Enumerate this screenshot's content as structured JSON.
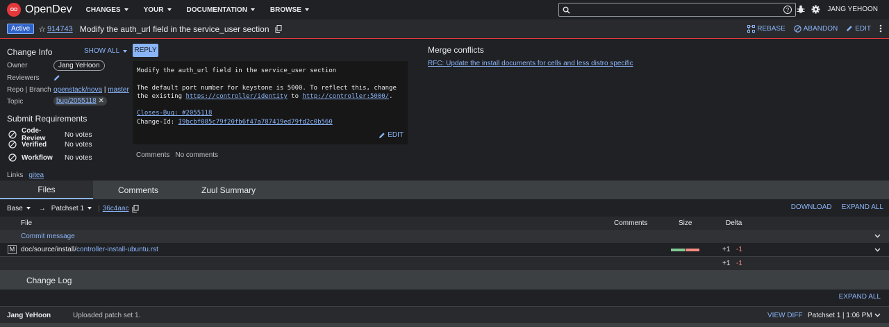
{
  "header": {
    "logo_text": "OpenDev",
    "logo_mark": "OD",
    "nav": [
      "CHANGES",
      "YOUR",
      "DOCUMENTATION",
      "BROWSE"
    ],
    "search_placeholder": "",
    "user": "JANG YEHOON"
  },
  "change": {
    "status": "Active",
    "number": "914743",
    "subject": "Modify the auth_url field in the service_user section",
    "actions": [
      "REBASE",
      "ABANDON",
      "EDIT"
    ]
  },
  "info": {
    "title": "Change Info",
    "show_all": "SHOW ALL",
    "owner_label": "Owner",
    "owner": "Jang YeHoon",
    "reviewers_label": "Reviewers",
    "repo_label": "Repo | Branch",
    "repo": "openstack/nova",
    "sep": "|",
    "branch": "master",
    "topic_label": "Topic",
    "topic": "bug/2055118"
  },
  "requirements": {
    "title": "Submit Requirements",
    "items": [
      {
        "name": "Code-Review",
        "votes": "No votes"
      },
      {
        "name": "Verified",
        "votes": "No votes"
      },
      {
        "name": "Workflow",
        "votes": "No votes"
      }
    ]
  },
  "links": {
    "label": "Links",
    "items": [
      "gitea"
    ]
  },
  "commit": {
    "reply": "REPLY",
    "line1": "Modify the auth_url field in the service_user section",
    "line2": "The default port number for keystone is 5000. To reflect this, change",
    "line3_pre": "the existing ",
    "url1": "https://controller/identity",
    "line3_mid": " to ",
    "url2": "http://controller:5000/",
    "line3_post": ".",
    "closes": "Closes-Bug: #2055118",
    "change_id_label": "Change-Id: ",
    "change_id": "I9bcbf085c79f20fb6f47a787419ed79fd2c0b560",
    "edit": "EDIT",
    "comments_label": "Comments",
    "comments_value": "No comments"
  },
  "merge": {
    "title": "Merge conflicts",
    "link": "RFC: Update the install documents for cells and less distro specific"
  },
  "tabs": [
    "Files",
    "Comments",
    "Zuul Summary"
  ],
  "patchset": {
    "base": "Base",
    "arrow": "→",
    "patchset": "Patchset 1",
    "commit": "36c4aac",
    "download": "DOWNLOAD",
    "expand_all": "EXPAND ALL"
  },
  "files": {
    "headers": {
      "file": "File",
      "comments": "Comments",
      "size": "Size",
      "delta": "Delta"
    },
    "commit_message": "Commit message",
    "rows": [
      {
        "status": "M",
        "path_prefix": "doc/source/install/",
        "path_name": "controller-install-ubuntu.rst",
        "added": "+1",
        "removed": "-1"
      }
    ],
    "total": {
      "added": "+1",
      "removed": "-1"
    }
  },
  "changelog": {
    "title": "Change Log",
    "expand_all": "EXPAND ALL",
    "entries": [
      {
        "author": "Jang YeHoon",
        "message": "Uploaded patch set 1.",
        "view_diff": "VIEW DIFF",
        "meta": "Patchset 1 | 1:06 PM"
      }
    ]
  },
  "colors": {
    "accent": "#8ab4f8",
    "status_badge": "#2e62c9",
    "brand": "#e5383b",
    "added": "#81c995",
    "removed": "#f28b82"
  }
}
